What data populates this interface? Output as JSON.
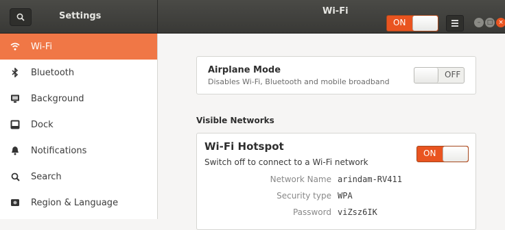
{
  "header": {
    "sidebar_title": "Settings",
    "panel_title": "Wi-Fi",
    "wifi_toggle": "ON"
  },
  "sidebar": {
    "items": [
      {
        "label": "Wi-Fi",
        "icon": "wifi-icon",
        "active": true
      },
      {
        "label": "Bluetooth",
        "icon": "bluetooth-icon"
      },
      {
        "label": "Background",
        "icon": "background-icon"
      },
      {
        "label": "Dock",
        "icon": "dock-icon"
      },
      {
        "label": "Notifications",
        "icon": "bell-icon"
      },
      {
        "label": "Search",
        "icon": "search-icon"
      },
      {
        "label": "Region & Language",
        "icon": "region-icon"
      }
    ]
  },
  "airplane": {
    "title": "Airplane Mode",
    "description": "Disables Wi-Fi, Bluetooth and mobile broadband",
    "toggle": "OFF"
  },
  "visible_networks": {
    "heading": "Visible Networks"
  },
  "hotspot": {
    "title": "Wi-Fi Hotspot",
    "description": "Switch off to connect to a Wi-Fi network",
    "toggle": "ON",
    "network_name_label": "Network Name",
    "network_name": "arindam-RV411",
    "security_type_label": "Security type",
    "security_type": "WPA",
    "password_label": "Password",
    "password": "viZsz6IK"
  },
  "colors": {
    "accent": "#e95420",
    "sidebar_active": "#f07746",
    "header_bg": "#3f3f3c"
  }
}
